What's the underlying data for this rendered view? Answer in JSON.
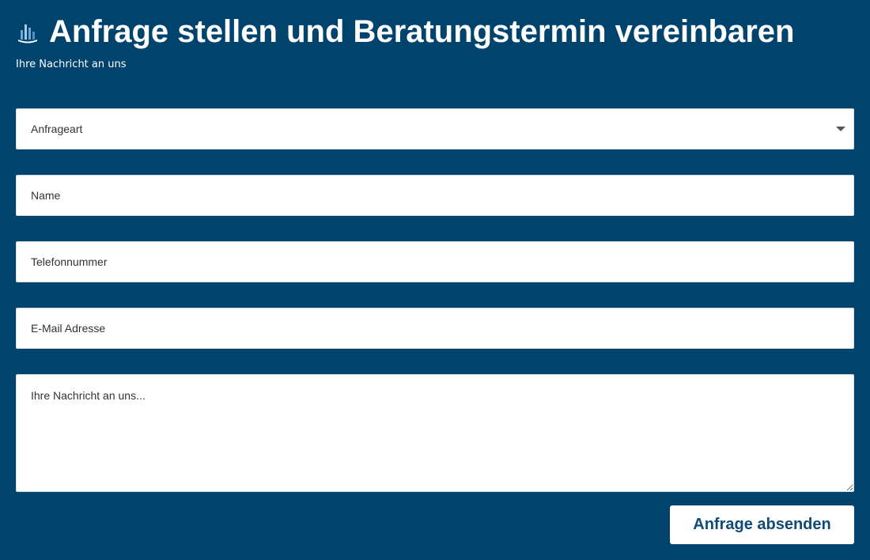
{
  "header": {
    "title": "Anfrage stellen und Beratungstermin vereinbaren",
    "subtitle": "Ihre Nachricht an uns",
    "logo_icon": "company-logo-icon"
  },
  "form": {
    "request_type": {
      "selected": "Anfrageart",
      "icon": "chevron-down-icon"
    },
    "name": {
      "placeholder": "Name",
      "value": ""
    },
    "phone": {
      "placeholder": "Telefonnummer",
      "value": ""
    },
    "email": {
      "placeholder": "E-Mail Adresse",
      "value": ""
    },
    "message": {
      "placeholder": "Ihre Nachricht an uns...",
      "value": ""
    },
    "submit_label": "Anfrage absenden"
  },
  "colors": {
    "background": "#00446d",
    "field_background": "#ffffff",
    "button_text": "#0f4a78",
    "title_text": "#ffffff"
  }
}
